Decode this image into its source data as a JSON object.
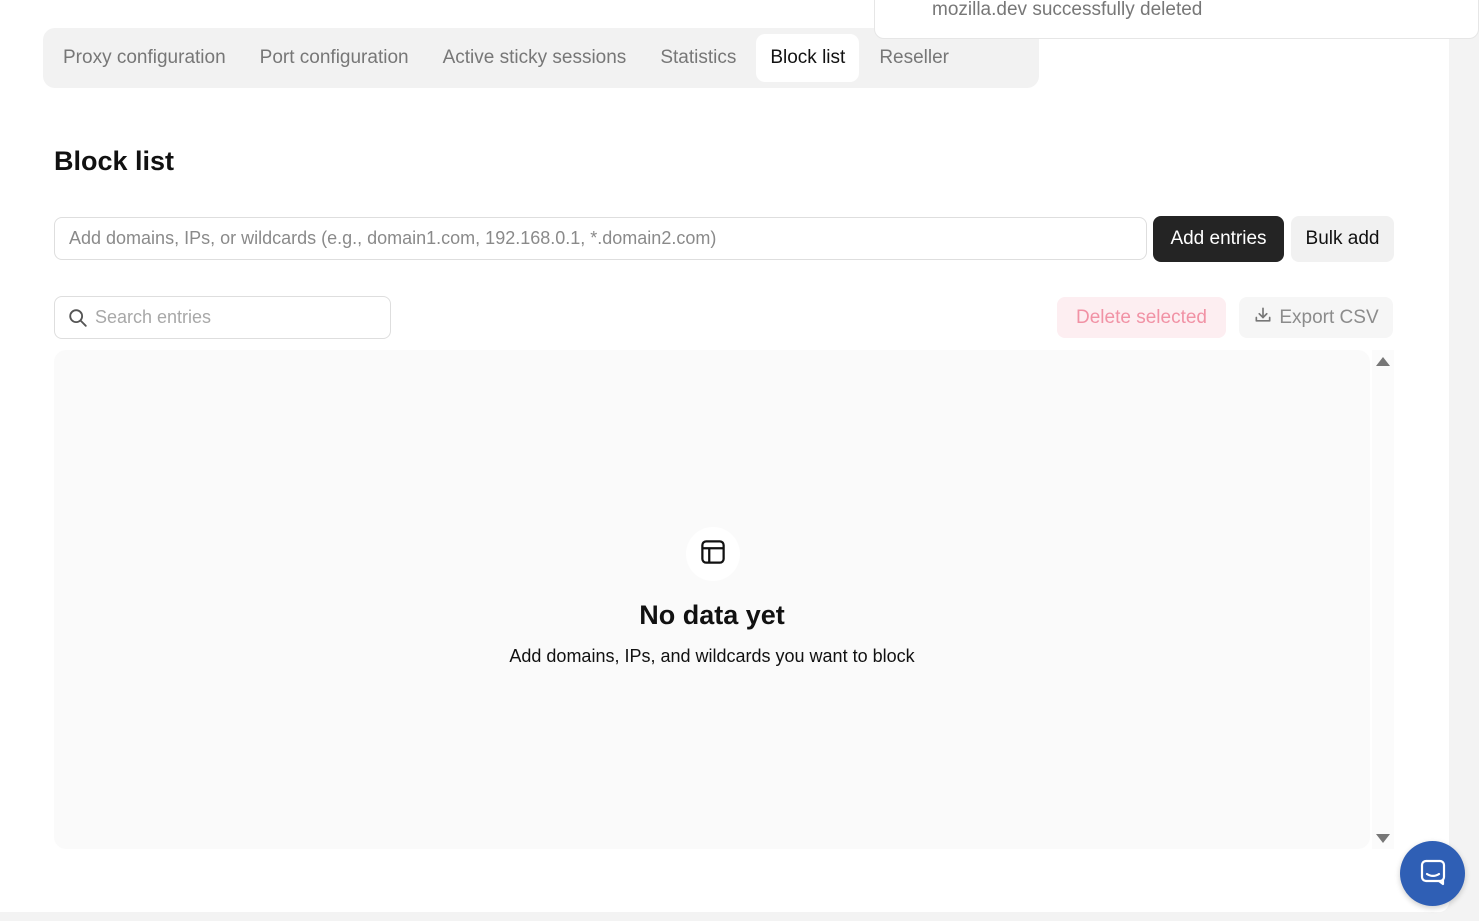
{
  "tabs": [
    {
      "label": "Proxy configuration",
      "active": false
    },
    {
      "label": "Port configuration",
      "active": false
    },
    {
      "label": "Active sticky sessions",
      "active": false
    },
    {
      "label": "Statistics",
      "active": false
    },
    {
      "label": "Block list",
      "active": true
    },
    {
      "label": "Reseller",
      "active": false
    }
  ],
  "page_title": "Block list",
  "add_entries": {
    "placeholder": "Add domains, IPs, or wildcards (e.g., domain1.com, 192.168.0.1, *.domain2.com)",
    "value": "",
    "add_button": "Add entries",
    "bulk_button": "Bulk add"
  },
  "search": {
    "placeholder": "Search entries",
    "value": "",
    "icon": "search-icon"
  },
  "actions": {
    "delete_selected": "Delete selected",
    "export_csv": "Export CSV",
    "export_icon": "download-icon"
  },
  "empty_state": {
    "icon": "layout-icon",
    "title": "No data yet",
    "subtitle": "Add domains, IPs, and wildcards you want to block"
  },
  "toast": {
    "message": "mozilla.dev successfully deleted"
  },
  "chat": {
    "icon": "chat-icon"
  },
  "colors": {
    "primary_button": "#242424",
    "danger_bg": "#fdeef1",
    "danger_text": "#f192a5",
    "chat_blue": "#2f5fb5"
  }
}
